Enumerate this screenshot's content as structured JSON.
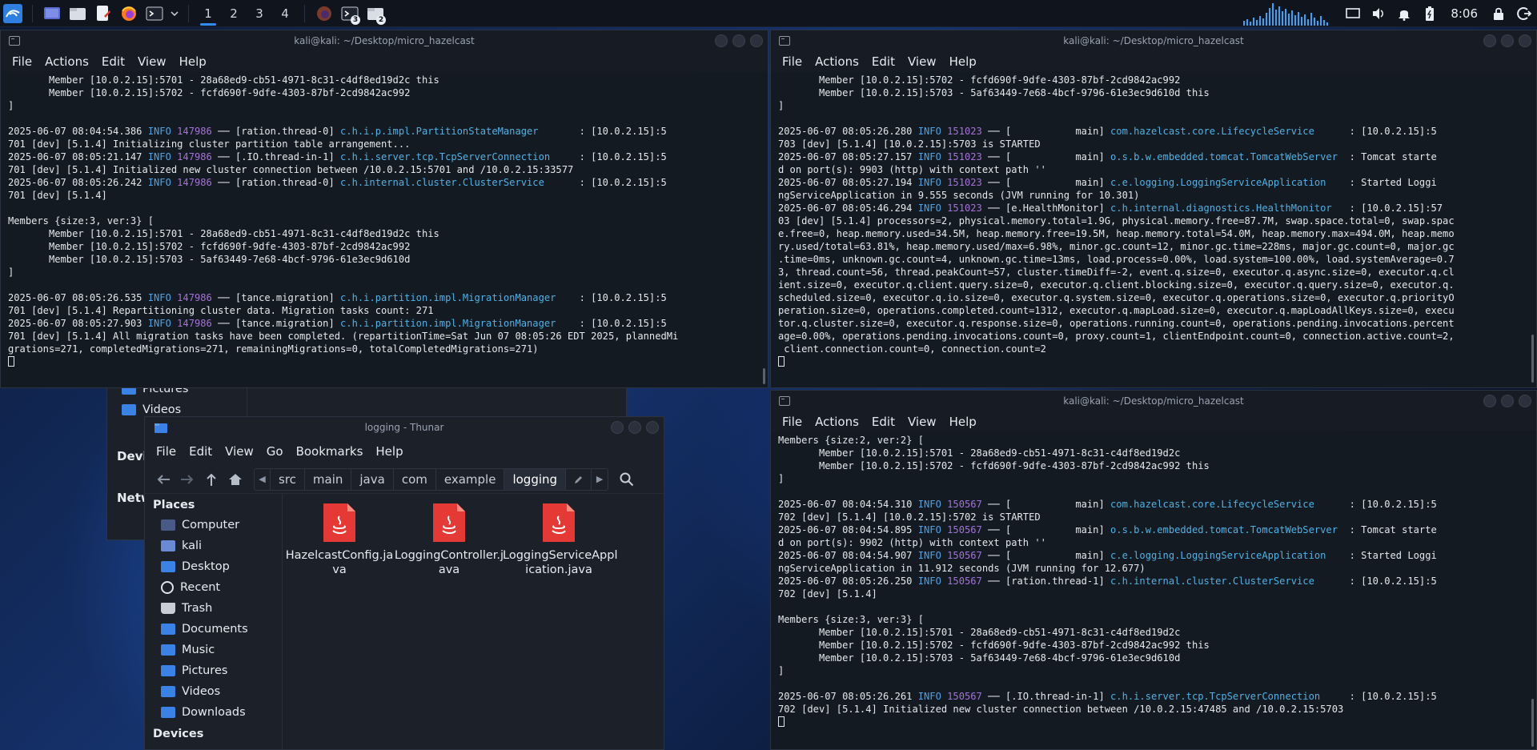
{
  "taskbar": {
    "workspaces": [
      "1",
      "2",
      "3",
      "4"
    ],
    "terminal_badge": "3",
    "files_badge": "2",
    "clock": "8:06"
  },
  "term1": {
    "title": "kali@kali: ~/Desktop/micro_hazelcast",
    "menu": [
      "File",
      "Actions",
      "Edit",
      "View",
      "Help"
    ],
    "lines": [
      {
        "t": "       Member [10.0.2.15]:5701 - 28a68ed9-cb51-4971-8c31-c4df8ed19d2c this"
      },
      {
        "t": "       Member [10.0.2.15]:5702 - fcfd690f-9dfe-4303-87bf-2cd9842ac992"
      },
      {
        "t": "]"
      },
      {
        "t": ""
      },
      {
        "ts": "2025-06-07 08:04:54.386",
        "lvl": "INFO",
        "pid": "147986",
        "th": " ── [ration.thread-0] ",
        "cls": "c.h.i.p.impl.PartitionStateManager       ",
        "rest": ": [10.0.2.15]:5"
      },
      {
        "t": "701 [dev] [5.1.4] Initializing cluster partition table arrangement..."
      },
      {
        "ts": "2025-06-07 08:05:21.147",
        "lvl": "INFO",
        "pid": "147986",
        "th": " ── [.IO.thread-in-1] ",
        "cls": "c.h.i.server.tcp.TcpServerConnection     ",
        "rest": ": [10.0.2.15]:5"
      },
      {
        "t": "701 [dev] [5.1.4] Initialized new cluster connection between /10.0.2.15:5701 and /10.0.2.15:33577"
      },
      {
        "ts": "2025-06-07 08:05:26.242",
        "lvl": "INFO",
        "pid": "147986",
        "th": " ── [ration.thread-0] ",
        "cls": "c.h.internal.cluster.ClusterService      ",
        "rest": ": [10.0.2.15]:5"
      },
      {
        "t": "701 [dev] [5.1.4]"
      },
      {
        "t": ""
      },
      {
        "t": "Members {size:3, ver:3} ["
      },
      {
        "t": "       Member [10.0.2.15]:5701 - 28a68ed9-cb51-4971-8c31-c4df8ed19d2c this"
      },
      {
        "t": "       Member [10.0.2.15]:5702 - fcfd690f-9dfe-4303-87bf-2cd9842ac992"
      },
      {
        "t": "       Member [10.0.2.15]:5703 - 5af63449-7e68-4bcf-9796-61e3ec9d610d"
      },
      {
        "t": "]"
      },
      {
        "t": ""
      },
      {
        "ts": "2025-06-07 08:05:26.535",
        "lvl": "INFO",
        "pid": "147986",
        "th": " ── [tance.migration] ",
        "cls": "c.h.i.partition.impl.MigrationManager    ",
        "rest": ": [10.0.2.15]:5"
      },
      {
        "t": "701 [dev] [5.1.4] Repartitioning cluster data. Migration tasks count: 271"
      },
      {
        "ts": "2025-06-07 08:05:27.903",
        "lvl": "INFO",
        "pid": "147986",
        "th": " ── [tance.migration] ",
        "cls": "c.h.i.partition.impl.MigrationManager    ",
        "rest": ": [10.0.2.15]:5"
      },
      {
        "t": "701 [dev] [5.1.4] All migration tasks have been completed. (repartitionTime=Sat Jun 07 08:05:26 EDT 2025, plannedMi"
      },
      {
        "t": "grations=271, completedMigrations=271, remainingMigrations=0, totalCompletedMigrations=271)"
      },
      {
        "cursor": true
      }
    ]
  },
  "term2": {
    "title": "kali@kali: ~/Desktop/micro_hazelcast",
    "menu": [
      "File",
      "Actions",
      "Edit",
      "View",
      "Help"
    ],
    "lines": [
      {
        "t": "       Member [10.0.2.15]:5702 - fcfd690f-9dfe-4303-87bf-2cd9842ac992"
      },
      {
        "t": "       Member [10.0.2.15]:5703 - 5af63449-7e68-4bcf-9796-61e3ec9d610d this"
      },
      {
        "t": "]"
      },
      {
        "t": ""
      },
      {
        "ts": "2025-06-07 08:05:26.280",
        "lvl": "INFO",
        "pid": "151023",
        "th": " ── [           main] ",
        "cls": "com.hazelcast.core.LifecycleService      ",
        "rest": ": [10.0.2.15]:5"
      },
      {
        "t": "703 [dev] [5.1.4] [10.0.2.15]:5703 is STARTED"
      },
      {
        "ts": "2025-06-07 08:05:27.157",
        "lvl": "INFO",
        "pid": "151023",
        "th": " ── [           main] ",
        "cls": "o.s.b.w.embedded.tomcat.TomcatWebServer  ",
        "rest": ": Tomcat starte"
      },
      {
        "t": "d on port(s): 9903 (http) with context path ''"
      },
      {
        "ts": "2025-06-07 08:05:27.194",
        "lvl": "INFO",
        "pid": "151023",
        "th": " ── [           main] ",
        "cls": "c.e.logging.LoggingServiceApplication    ",
        "rest": ": Started Loggi"
      },
      {
        "t": "ngServiceApplication in 9.555 seconds (JVM running for 10.301)"
      },
      {
        "ts": "2025-06-07 08:05:46.294",
        "lvl": "INFO",
        "pid": "151023",
        "th": " ── [e.HealthMonitor] ",
        "cls": "c.h.internal.diagnostics.HealthMonitor   ",
        "rest": ": [10.0.2.15]:57"
      },
      {
        "t": "03 [dev] [5.1.4] processors=2, physical.memory.total=1.9G, physical.memory.free=87.7M, swap.space.total=0, swap.spac"
      },
      {
        "t": "e.free=0, heap.memory.used=34.5M, heap.memory.free=19.5M, heap.memory.total=54.0M, heap.memory.max=494.0M, heap.memo"
      },
      {
        "t": "ry.used/total=63.81%, heap.memory.used/max=6.98%, minor.gc.count=12, minor.gc.time=228ms, major.gc.count=0, major.gc"
      },
      {
        "t": ".time=0ms, unknown.gc.count=4, unknown.gc.time=13ms, load.process=0.00%, load.system=100.00%, load.systemAverage=0.7"
      },
      {
        "t": "3, thread.count=56, thread.peakCount=57, cluster.timeDiff=-2, event.q.size=0, executor.q.async.size=0, executor.q.cl"
      },
      {
        "t": "ient.size=0, executor.q.client.query.size=0, executor.q.client.blocking.size=0, executor.q.query.size=0, executor.q."
      },
      {
        "t": "scheduled.size=0, executor.q.io.size=0, executor.q.system.size=0, executor.q.operations.size=0, executor.q.priorityO"
      },
      {
        "t": "peration.size=0, operations.completed.count=1312, executor.q.mapLoad.size=0, executor.q.mapLoadAllKeys.size=0, execu"
      },
      {
        "t": "tor.q.cluster.size=0, executor.q.response.size=0, operations.running.count=0, operations.pending.invocations.percent"
      },
      {
        "t": "age=0.00%, operations.pending.invocations.count=0, proxy.count=1, clientEndpoint.count=0, connection.active.count=2,"
      },
      {
        "t": " client.connection.count=0, connection.count=2"
      },
      {
        "cursor": true
      }
    ]
  },
  "term3": {
    "title": "kali@kali: ~/Desktop/micro_hazelcast",
    "menu": [
      "File",
      "Actions",
      "Edit",
      "View",
      "Help"
    ],
    "lines": [
      {
        "t": "Members {size:2, ver:2} ["
      },
      {
        "t": "       Member [10.0.2.15]:5701 - 28a68ed9-cb51-4971-8c31-c4df8ed19d2c"
      },
      {
        "t": "       Member [10.0.2.15]:5702 - fcfd690f-9dfe-4303-87bf-2cd9842ac992 this"
      },
      {
        "t": "]"
      },
      {
        "t": ""
      },
      {
        "ts": "2025-06-07 08:04:54.310",
        "lvl": "INFO",
        "pid": "150567",
        "th": " ── [           main] ",
        "cls": "com.hazelcast.core.LifecycleService      ",
        "rest": ": [10.0.2.15]:5"
      },
      {
        "t": "702 [dev] [5.1.4] [10.0.2.15]:5702 is STARTED"
      },
      {
        "ts": "2025-06-07 08:04:54.895",
        "lvl": "INFO",
        "pid": "150567",
        "th": " ── [           main] ",
        "cls": "o.s.b.w.embedded.tomcat.TomcatWebServer  ",
        "rest": ": Tomcat starte"
      },
      {
        "t": "d on port(s): 9902 (http) with context path ''"
      },
      {
        "ts": "2025-06-07 08:04:54.907",
        "lvl": "INFO",
        "pid": "150567",
        "th": " ── [           main] ",
        "cls": "c.e.logging.LoggingServiceApplication    ",
        "rest": ": Started Loggi"
      },
      {
        "t": "ngServiceApplication in 11.912 seconds (JVM running for 12.677)"
      },
      {
        "ts": "2025-06-07 08:05:26.250",
        "lvl": "INFO",
        "pid": "150567",
        "th": " ── [ration.thread-1] ",
        "cls": "c.h.internal.cluster.ClusterService      ",
        "rest": ": [10.0.2.15]:5"
      },
      {
        "t": "702 [dev] [5.1.4]"
      },
      {
        "t": ""
      },
      {
        "t": "Members {size:3, ver:3} ["
      },
      {
        "t": "       Member [10.0.2.15]:5701 - 28a68ed9-cb51-4971-8c31-c4df8ed19d2c"
      },
      {
        "t": "       Member [10.0.2.15]:5702 - fcfd690f-9dfe-4303-87bf-2cd9842ac992 this"
      },
      {
        "t": "       Member [10.0.2.15]:5703 - 5af63449-7e68-4bcf-9796-61e3ec9d610d"
      },
      {
        "t": "]"
      },
      {
        "t": ""
      },
      {
        "ts": "2025-06-07 08:05:26.261",
        "lvl": "INFO",
        "pid": "150567",
        "th": " ── [.IO.thread-in-1] ",
        "cls": "c.h.i.server.tcp.TcpServerConnection     ",
        "rest": ": [10.0.2.15]:5"
      },
      {
        "t": "702 [dev] [5.1.4] Initialized new cluster connection between /10.0.2.15:47485 and /10.0.2.15:5703"
      },
      {
        "cursor": true
      }
    ]
  },
  "bg_filemanager": {
    "items": [
      "Pictures",
      "Videos"
    ],
    "sections": [
      "Devic",
      "Netw"
    ]
  },
  "thunar": {
    "title": "logging - Thunar",
    "menu": [
      "File",
      "Edit",
      "View",
      "Go",
      "Bookmarks",
      "Help"
    ],
    "crumbs": [
      "src",
      "main",
      "java",
      "com",
      "example",
      "logging"
    ],
    "places_heading": "Places",
    "places": [
      {
        "label": "Computer",
        "icon": "computer"
      },
      {
        "label": "kali",
        "icon": "home"
      },
      {
        "label": "Desktop",
        "icon": "folder"
      },
      {
        "label": "Recent",
        "icon": "recent"
      },
      {
        "label": "Trash",
        "icon": "trash"
      },
      {
        "label": "Documents",
        "icon": "folder"
      },
      {
        "label": "Music",
        "icon": "folder"
      },
      {
        "label": "Pictures",
        "icon": "folder"
      },
      {
        "label": "Videos",
        "icon": "folder"
      },
      {
        "label": "Downloads",
        "icon": "folder"
      }
    ],
    "devices_heading": "Devices",
    "files": [
      {
        "line1": "HazelcastConfig.ja",
        "line2": "va"
      },
      {
        "line1": "LoggingController.j",
        "line2": "ava"
      },
      {
        "line1": "LoggingServiceAppl",
        "line2": "ication.java"
      }
    ],
    "accent": "#e53935"
  }
}
